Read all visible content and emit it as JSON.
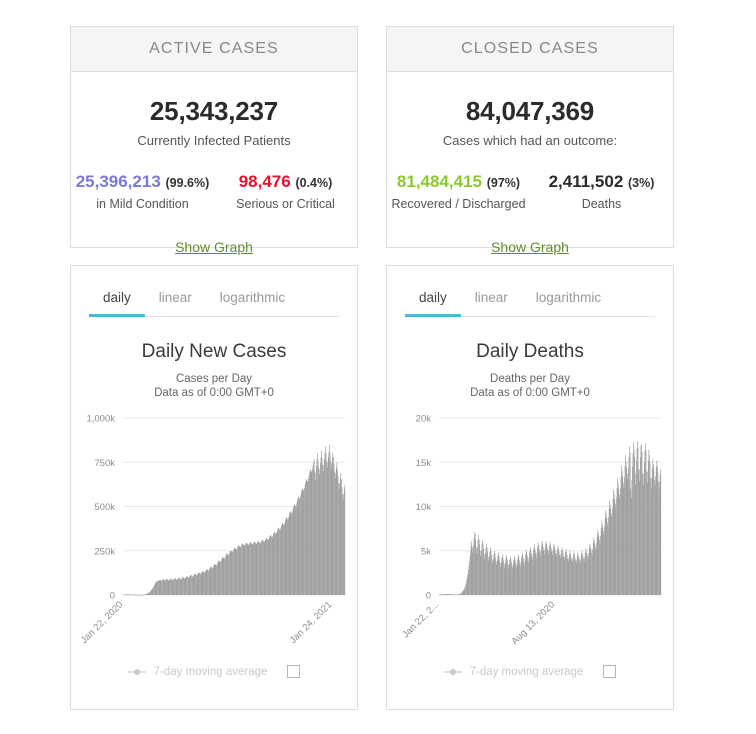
{
  "cards": {
    "active": {
      "header": "ACTIVE CASES",
      "total": "25,343,237",
      "total_caption": "Currently Infected Patients",
      "left": {
        "value": "25,396,213",
        "pct": "(99.6%)",
        "label": "in Mild Condition",
        "color": "#7b77e0"
      },
      "right": {
        "value": "98,476",
        "pct": "(0.4%)",
        "label": "Serious or Critical",
        "color": "#e8112d"
      },
      "show_graph": "Show Graph"
    },
    "closed": {
      "header": "CLOSED CASES",
      "total": "84,047,369",
      "total_caption": "Cases which had an outcome:",
      "left": {
        "value": "81,484,415",
        "pct": "(97%)",
        "label": "Recovered / Discharged",
        "color": "#8aca2b"
      },
      "right": {
        "value": "2,411,502",
        "pct": "(3%)",
        "label": "Deaths",
        "color": "#2b2b2b"
      },
      "show_graph": "Show Graph"
    }
  },
  "tabs": {
    "daily": "daily",
    "linear": "linear",
    "logarithmic": "logarithmic"
  },
  "legend": {
    "text": "7-day moving average",
    "marker": "line-dot-marker",
    "checkbox": "moving-average-checkbox"
  },
  "theme": {
    "accent_tab": "#4fb8d8",
    "bar_color": "#a0a0a0",
    "grid_color": "#e8e8e8",
    "link_green": "#5f8c2f"
  },
  "chart_data": [
    {
      "id": "daily-new-cases",
      "type": "bar",
      "title": "Daily New Cases",
      "subtitle_line1": "Cases per Day",
      "subtitle_line2": "Data as of 0:00 GMT+0",
      "xlabel": "",
      "ylabel": "",
      "ylim": [
        0,
        1000000
      ],
      "grid": true,
      "legend_position": "bottom",
      "ytick_values": [
        0,
        250000,
        500000,
        750000,
        1000000
      ],
      "ytick_labels": [
        "0",
        "250k",
        "500k",
        "750k",
        "1,000k"
      ],
      "xtick_labels": [
        "Jan 22, 2020",
        "Jan 24, 2021"
      ],
      "xtick_positions": [
        0,
        368
      ],
      "x_start": "Jan 22, 2020",
      "x_end": "Jan 24, 2021",
      "series": [
        {
          "name": "Daily New Cases",
          "values": [
            1000,
            1200,
            1500,
            2000,
            2600,
            3000,
            3800,
            4000,
            3300,
            3900,
            3200,
            3200,
            2700,
            2900,
            2100,
            2100,
            2500,
            3200,
            2700,
            2500,
            2100,
            1700,
            1600,
            1300,
            1200,
            1100,
            1000,
            900,
            800,
            700,
            700,
            700,
            700,
            900,
            1200,
            1500,
            2000,
            2600,
            3500,
            4500,
            5800,
            7000,
            8500,
            10000,
            12000,
            14000,
            16500,
            19000,
            22000,
            26000,
            30000,
            35000,
            40000,
            46000,
            52000,
            58000,
            64000,
            70000,
            73000,
            76000,
            78000,
            80000,
            82000,
            83000,
            85000,
            86000,
            82000,
            79000,
            82000,
            88000,
            90000,
            88000,
            84000,
            80000,
            84000,
            88000,
            90000,
            92000,
            88000,
            84000,
            80000,
            84000,
            88000,
            92000,
            94000,
            90000,
            86000,
            82000,
            86000,
            90000,
            93000,
            96000,
            92000,
            88000,
            84000,
            88000,
            92000,
            96000,
            99000,
            95000,
            91000,
            87000,
            91000,
            95000,
            99000,
            103000,
            99000,
            95000,
            91000,
            95000,
            100000,
            104000,
            108000,
            104000,
            100000,
            96000,
            100000,
            105000,
            110000,
            114000,
            110000,
            106000,
            102000,
            107000,
            112000,
            117000,
            121000,
            117000,
            113000,
            109000,
            114000,
            119000,
            124000,
            128000,
            124000,
            120000,
            116000,
            121000,
            126000,
            131000,
            136000,
            132000,
            128000,
            124000,
            130000,
            136000,
            142000,
            147000,
            143000,
            139000,
            135000,
            141000,
            148000,
            155000,
            161000,
            157000,
            153000,
            149000,
            156000,
            163000,
            170000,
            177000,
            173000,
            169000,
            165000,
            173000,
            181000,
            189000,
            196000,
            192000,
            188000,
            184000,
            192000,
            200000,
            208000,
            216000,
            212000,
            208000,
            204000,
            212000,
            220000,
            228000,
            236000,
            232000,
            228000,
            224000,
            230000,
            238000,
            246000,
            253000,
            249000,
            245000,
            241000,
            247000,
            254000,
            261000,
            268000,
            264000,
            260000,
            256000,
            262000,
            269000,
            276000,
            282000,
            278000,
            274000,
            270000,
            275000,
            281000,
            287000,
            292000,
            288000,
            284000,
            278000,
            282000,
            287000,
            292000,
            296000,
            292000,
            287000,
            282000,
            286000,
            291000,
            296000,
            300000,
            295000,
            290000,
            285000,
            289000,
            294000,
            299000,
            303000,
            298000,
            293000,
            288000,
            292000,
            297000,
            302000,
            306000,
            301000,
            296000,
            291000,
            296000,
            302000,
            308000,
            313000,
            308000,
            303000,
            298000,
            304000,
            311000,
            318000,
            324000,
            319000,
            314000,
            309000,
            316000,
            324000,
            332000,
            339000,
            334000,
            329000,
            324000,
            332000,
            341000,
            350000,
            358000,
            353000,
            348000,
            343000,
            352000,
            362000,
            372000,
            381000,
            376000,
            371000,
            366000,
            376000,
            387000,
            398000,
            408000,
            403000,
            398000,
            393000,
            404000,
            416000,
            428000,
            439000,
            434000,
            429000,
            424000,
            436000,
            449000,
            462000,
            474000,
            469000,
            464000,
            459000,
            472000,
            486000,
            500000,
            513000,
            508000,
            503000,
            498000,
            512000,
            527000,
            542000,
            556000,
            551000,
            546000,
            541000,
            556000,
            572000,
            588000,
            603000,
            598000,
            593000,
            588000,
            604000,
            621000,
            638000,
            654000,
            649000,
            644000,
            639000,
            656000,
            674000,
            692000,
            709000,
            704000,
            699000,
            694000,
            712000,
            731000,
            750000,
            768000,
            700000,
            650000,
            690000,
            730000,
            770000,
            800000,
            760000,
            720000,
            680000,
            710000,
            745000,
            780000,
            815000,
            775000,
            735000,
            700000,
            735000,
            770000,
            805000,
            840000,
            800000,
            760000,
            720000,
            750000,
            780000,
            810000,
            845000,
            800000,
            755000,
            715000,
            745000,
            775000,
            805000,
            780000,
            740000,
            700000,
            660000,
            690000,
            720000,
            750000,
            710000,
            670000,
            630000,
            600000,
            630000,
            660000,
            690000,
            650000,
            610000,
            570000,
            540000,
            570000,
            600000,
            620000
          ]
        }
      ]
    },
    {
      "id": "daily-deaths",
      "type": "bar",
      "title": "Daily Deaths",
      "subtitle_line1": "Deaths per Day",
      "subtitle_line2": "Data as of 0:00 GMT+0",
      "xlabel": "",
      "ylabel": "",
      "ylim": [
        0,
        20000
      ],
      "grid": true,
      "legend_position": "bottom",
      "ytick_values": [
        0,
        5000,
        10000,
        15000,
        20000
      ],
      "ytick_labels": [
        "0",
        "5k",
        "10k",
        "15k",
        "20k"
      ],
      "xtick_labels": [
        "Jan 22, 2...",
        "Aug 13, 2020"
      ],
      "xtick_positions": [
        0,
        204
      ],
      "x_start": "Jan 22, 2020",
      "x_end": "Jan 24, 2021",
      "series": [
        {
          "name": "Daily Deaths",
          "values": [
            20,
            25,
            30,
            40,
            50,
            60,
            70,
            80,
            90,
            100,
            95,
            100,
            110,
            100,
            95,
            90,
            85,
            95,
            100,
            105,
            95,
            90,
            85,
            80,
            75,
            70,
            68,
            65,
            60,
            58,
            56,
            55,
            58,
            65,
            75,
            90,
            110,
            140,
            180,
            230,
            300,
            380,
            470,
            580,
            700,
            850,
            1050,
            1300,
            1600,
            1950,
            2350,
            2800,
            3300,
            3800,
            4400,
            5000,
            5600,
            6100,
            5400,
            4800,
            5600,
            6400,
            7100,
            6900,
            6200,
            5400,
            4700,
            5400,
            6200,
            6800,
            6300,
            5700,
            5000,
            4400,
            5000,
            5700,
            6200,
            5800,
            5200,
            4600,
            4100,
            4700,
            5300,
            5800,
            5400,
            4900,
            4300,
            3900,
            4400,
            4900,
            5400,
            5000,
            4500,
            4000,
            3600,
            4100,
            4600,
            5000,
            4700,
            4200,
            3800,
            3400,
            3900,
            4400,
            4800,
            4500,
            4000,
            3600,
            3200,
            3700,
            4200,
            4600,
            4300,
            3900,
            3500,
            3100,
            3600,
            4100,
            4500,
            4200,
            3800,
            3400,
            3000,
            3500,
            4000,
            4400,
            4100,
            3700,
            3300,
            3000,
            3500,
            4000,
            4400,
            4200,
            3800,
            3400,
            3100,
            3600,
            4100,
            4600,
            4300,
            3900,
            3500,
            3200,
            3800,
            4300,
            4800,
            4500,
            4100,
            3700,
            3400,
            4000,
            4600,
            5100,
            4800,
            4400,
            4000,
            3700,
            4300,
            4900,
            5400,
            5100,
            4700,
            4300,
            4000,
            4600,
            5200,
            5700,
            5400,
            5000,
            4600,
            4200,
            4800,
            5400,
            5900,
            5600,
            5200,
            4800,
            4400,
            5000,
            5600,
            6100,
            5800,
            5400,
            5000,
            4600,
            5200,
            5700,
            6100,
            5800,
            5400,
            5000,
            4600,
            5100,
            5600,
            6000,
            5700,
            5300,
            4900,
            4500,
            5000,
            5400,
            5800,
            5500,
            5100,
            4700,
            4400,
            4800,
            5200,
            5600,
            5300,
            4900,
            4500,
            4200,
            4600,
            5000,
            5400,
            5100,
            4700,
            4300,
            4000,
            4400,
            4800,
            5200,
            4900,
            4500,
            4100,
            3800,
            4200,
            4600,
            5000,
            4700,
            4300,
            4000,
            3700,
            4100,
            4500,
            4900,
            4600,
            4200,
            3900,
            3600,
            4000,
            4400,
            4800,
            4500,
            4200,
            3900,
            3600,
            4100,
            4600,
            5000,
            4700,
            4400,
            4100,
            3800,
            4300,
            4800,
            5300,
            5000,
            4700,
            4400,
            4100,
            4700,
            5300,
            5800,
            5500,
            5200,
            4800,
            4500,
            5200,
            5900,
            6500,
            6200,
            5800,
            5400,
            5100,
            5900,
            6700,
            7400,
            7000,
            6600,
            6200,
            5800,
            6700,
            7600,
            8400,
            8000,
            7600,
            7200,
            6800,
            7700,
            8700,
            9600,
            9200,
            8700,
            8200,
            7800,
            8800,
            9800,
            10700,
            10200,
            9700,
            9200,
            8800,
            9800,
            10900,
            11900,
            11400,
            10800,
            10300,
            9800,
            11000,
            12100,
            13200,
            12600,
            12000,
            11400,
            10900,
            12100,
            13400,
            14600,
            14000,
            13400,
            12700,
            12100,
            13300,
            14600,
            15800,
            15100,
            14400,
            13700,
            13100,
            14300,
            15600,
            16800,
            16100,
            12000,
            11000,
            13000,
            14500,
            16000,
            17200,
            16400,
            15600,
            12500,
            13800,
            15200,
            16500,
            17400,
            16600,
            14200,
            12800,
            14200,
            15600,
            16900,
            17000,
            16200,
            13800,
            12400,
            13700,
            15000,
            16300,
            17200,
            16400,
            14000,
            12600,
            13900,
            15200,
            16400,
            15800,
            15000,
            13200,
            12000,
            13200,
            14400,
            15400,
            14800,
            14000,
            13000,
            12400,
            13400,
            14400,
            15200,
            14600,
            13800,
            12800,
            12000,
            12800,
            13600,
            14200
          ]
        }
      ]
    }
  ]
}
